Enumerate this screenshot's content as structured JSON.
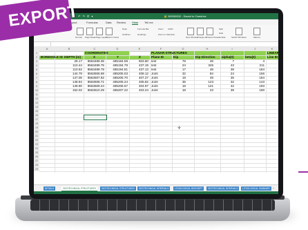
{
  "badge": {
    "label": "EXPORT"
  },
  "titlebar": {
    "quick_access": "⬛ ↶ ↷ ⊡ ▾",
    "document": "🔒 NS000002 - Saved to Onedrive"
  },
  "ribbon_tabs": [
    "File",
    "Home",
    "Page Layout",
    "Formulas",
    "Data",
    "Review",
    "View",
    "Tell me"
  ],
  "ribbon_active_tab": "View",
  "ribbon_labels": [
    "Normal",
    "Page Break",
    "Page Layout",
    "Custom Views",
    "Ruler",
    "Formula Bar",
    "Gridlines",
    "Headings",
    "Zoom",
    "100%",
    "Zoom to Selection",
    "New Window",
    "Arrange All",
    "Freeze Panes",
    "Split",
    "Hide",
    "Unhide",
    "Switch Windows",
    "Macros"
  ],
  "columns": [
    "A",
    "B",
    "C",
    "D",
    "E",
    "F",
    "G",
    "H",
    "I",
    "J",
    "K"
  ],
  "sheet": {
    "r1": {
      "c": "COORDINATES",
      "f": "PLANAR STRUCTURES",
      "k": "LINEAR STR..."
    },
    "r2": {
      "a": "BOREHOLE ID",
      "b": "DEPTH (m)",
      "c": "X",
      "d": "Y",
      "e": "Z",
      "f": "Plane ID",
      "g": "Dip",
      "h": "Dip Direction",
      "i": "alpha(0)",
      "j": "beta(0)",
      "k": "Line ID"
    },
    "rows": [
      {
        "b": "28.17",
        "c": "8563489.35",
        "d": "485184.59",
        "e": "503.80",
        "f": "test",
        "g": "78",
        "h": "28",
        "i": "7",
        "j": "4"
      },
      {
        "b": "110.44",
        "c": "8563489.75",
        "d": "485194.79",
        "e": "437.19",
        "f": "test",
        "g": "24",
        "h": "345",
        "i": "43",
        "j": "211"
      },
      {
        "b": "110.52",
        "c": "8563489.79",
        "d": "485194.81",
        "e": "437.13",
        "f": "test",
        "g": "17",
        "h": "48",
        "i": "38",
        "j": "184"
      },
      {
        "b": "144.79",
        "c": "8563506.69",
        "d": "485205.03",
        "e": "408.12",
        "f": "Joint",
        "g": "32",
        "h": "84",
        "i": "24",
        "j": "166"
      },
      {
        "b": "147.06",
        "c": "8563507.82",
        "d": "485205.70",
        "e": "407.27",
        "f": "Joint",
        "g": "19",
        "h": "49",
        "i": "35",
        "j": "184"
      },
      {
        "b": "148.84",
        "c": "8563508.71",
        "d": "485206.24",
        "e": "405.82",
        "f": "Joint",
        "g": "35",
        "h": "123",
        "i": "32",
        "j": "143"
      },
      {
        "b": "149.90",
        "c": "8563509.24",
        "d": "485206.57",
        "e": "404.97",
        "f": "Joint",
        "g": "18",
        "h": "121",
        "i": "42",
        "j": "193"
      },
      {
        "b": "152.02",
        "c": "8563510.29",
        "d": "485207.22",
        "e": "403.24",
        "f": "Joint",
        "g": "18",
        "h": "23",
        "i": "39",
        "j": "190"
      }
    ],
    "row_numbers": [
      "1",
      "2",
      "3",
      "4",
      "5",
      "6",
      "7",
      "8",
      "9",
      "10",
      "11",
      "12",
      "13",
      "14",
      "15",
      "16",
      "17",
      "18",
      "19",
      "20",
      "21",
      "22",
      "23",
      "24",
      "25",
      "26",
      "27",
      "28",
      "29"
    ]
  },
  "sheet_tabs": [
    "DETAILS",
    "GEOTECHNICAL STRUCTURES",
    "GEOTECHNICAL STRUCTURES",
    "GEOTECHNICAL INTERVALS",
    "LITHOLOGICAL DESCRIPT",
    "GEOTECHNICAL INTERVALS",
    "LITHOLOGICAL SUMMARY",
    "+"
  ],
  "active_sheet_index": 1,
  "colors": {
    "excel_green": "#207245",
    "header_band": "#8fd14f",
    "badge": "#9b2ea8",
    "sheet_tab": "#3f86c9"
  }
}
